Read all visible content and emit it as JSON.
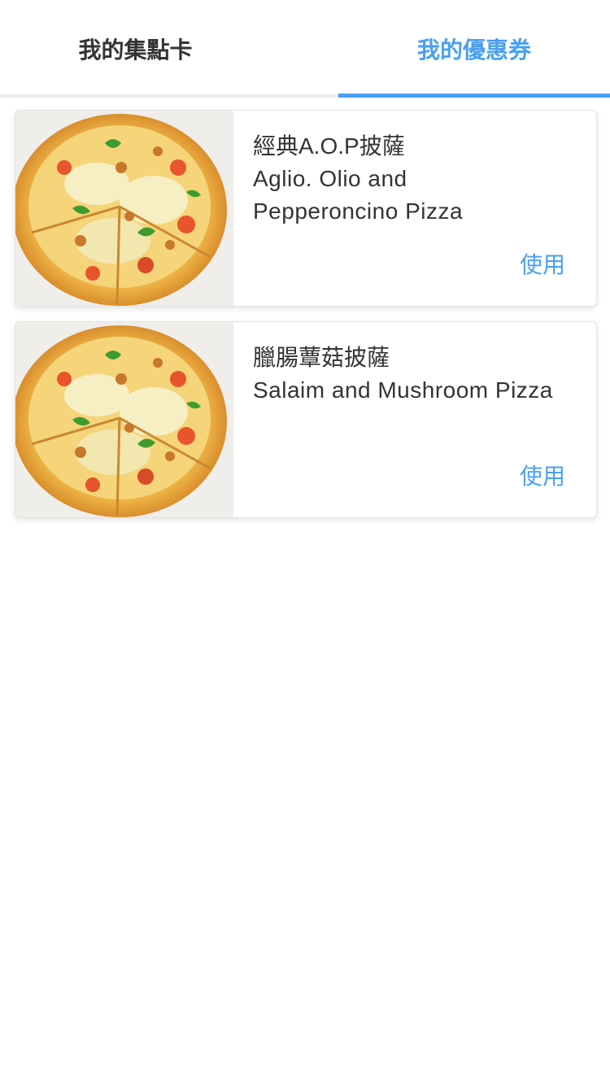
{
  "tabs": {
    "points_card_label": "我的集點卡",
    "coupons_label": "我的優惠券",
    "active": "coupons",
    "accent_color": "#4a9ff0"
  },
  "coupons": [
    {
      "title_zh": "經典A.O.P披薩",
      "title_en_line1": "Aglio. Olio and",
      "title_en_line2": "Pepperoncino Pizza",
      "use_label": "使用",
      "image_icon": "pizza-image"
    },
    {
      "title_zh": "臘腸蕈菇披薩",
      "title_en_line1": "Salaim and Mushroom Pizza",
      "title_en_line2": "",
      "use_label": "使用",
      "image_icon": "pizza-image"
    }
  ]
}
